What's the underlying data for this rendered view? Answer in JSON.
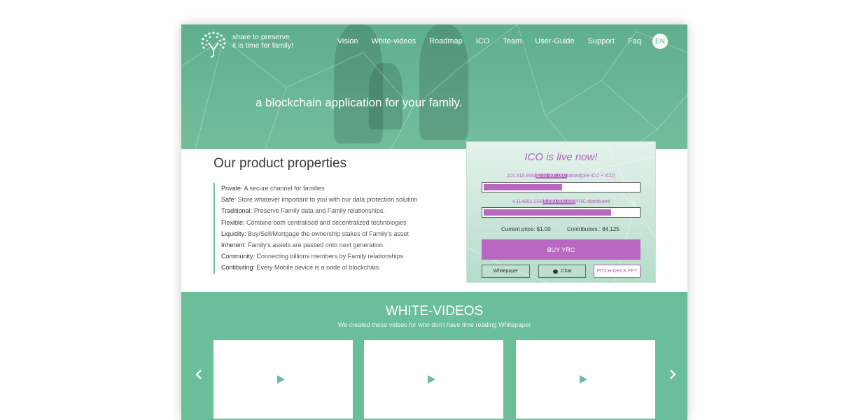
{
  "brand": {
    "line1": "share to preserve",
    "line2": "it is time for family!"
  },
  "nav": {
    "items": [
      "Vision",
      "White-videos",
      "Roadmap",
      "ICO",
      "Team",
      "User-Guide",
      "Support",
      "Faq"
    ],
    "lang": "EN"
  },
  "hero": {
    "tagline": "a blockchain application for your family."
  },
  "properties": {
    "title": "Our product properties",
    "items": [
      {
        "label": "Private",
        "text": ": A secure channel for families"
      },
      {
        "label": "Safe",
        "text": ": Store whatever important to you with our data protection solution"
      },
      {
        "label": "Traditional",
        "text": ": Preserve Family data and Family relationships."
      },
      {
        "label": "Flexible",
        "text": ": Combine both centralised and decentralized technologies"
      },
      {
        "label": "Liquidity",
        "text": ": Buy/Sell/Mortgage the ownership stakes of Family's asset"
      },
      {
        "label": "Inherent",
        "text": ": Family's assets are passed onto next generation."
      },
      {
        "label": "Community",
        "text": ": Connecting billions members by Family relationships"
      },
      {
        "label": "Contibuting",
        "text": ": Every Mobile device is a node of blockchain."
      }
    ]
  },
  "ico": {
    "title": "ICO is live now!",
    "raised_current": "101.410.846/",
    "raised_target": "$200.000.000",
    "raised_suffix": "raised(pre-ICO + ICO)",
    "raised_fraction": 0.507,
    "dist_current": "4.114802.233/",
    "dist_target": "5.000.000.000",
    "dist_suffix": "YRC distributed",
    "dist_fraction": 0.823,
    "price": "Current price: $1.00",
    "contributors": "Contributors : 84.125",
    "buy_label": "BUY YRC",
    "whitepaper_label": "Whitepaper",
    "chat_label": "Chat",
    "deck_label": "PITCH-DECK PPT",
    "accent": "#b868c0"
  },
  "videos": {
    "title": "WHITE-VIDEOS",
    "subtitle": "We created these videos for who don't have time reading Whitepaper",
    "count": 3
  },
  "colors": {
    "green": "#6abf9a",
    "purple": "#b868c0"
  }
}
